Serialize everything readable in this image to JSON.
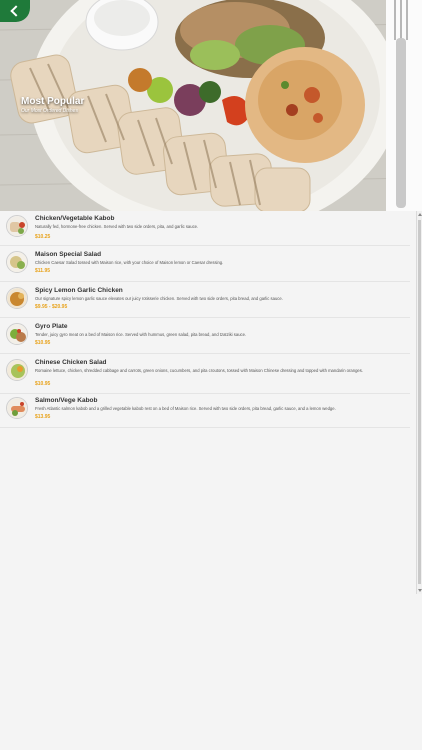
{
  "header": {
    "title": "Most Popular",
    "subtitle": "Our Most Ordered Dishes",
    "back_icon": "chevron-left-icon",
    "accent": "#1f7a3a"
  },
  "menu": {
    "price_color": "#e8a21a",
    "items": [
      {
        "name": "Chicken/Vegetable Kabob",
        "description": "Naturally fed, hormone-free chicken. Served with two side orders, pita, and garlic sauce.",
        "price": "$10.25"
      },
      {
        "name": "Maison Special Salad",
        "description": "Chicken Caesar Salad tossed with Maison rice, with your choice of Maison lemon or Caesar dressing.",
        "price": "$11.95"
      },
      {
        "name": "Spicy Lemon Garlic Chicken",
        "description": "Our signature spicy lemon garlic sauce elevates our juicy rotisserie chicken. Served with two side orders, pita bread, and garlic sauce.",
        "price": "$9.95 - $20.95"
      },
      {
        "name": "Gyro Plate",
        "description": "Tender, juicy gyro meat on a bed of Maison rice. Served with hummus, green salad, pita bread, and tzatziki sauce.",
        "price": "$10.95"
      },
      {
        "name": "Chinese Chicken Salad",
        "description": "Romaine lettuce, chicken, shredded cabbage and carrots, green onions, cucumbers, and pita croutons, tossed with Maison Chinese dressing and topped with mandarin oranges.",
        "price": "$10.95"
      },
      {
        "name": "Salmon/Vege Kabob",
        "description": "Fresh Atlantic salmon kabob and a grilled vegetable kabob rest on a bed of Maison rice. Served with two side orders, pita bread, garlic sauce, and a lemon wedge.",
        "price": "$13.95"
      }
    ]
  }
}
